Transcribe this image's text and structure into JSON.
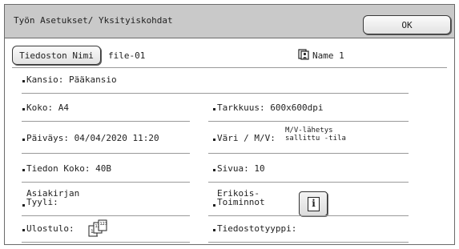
{
  "window": {
    "title": "Työn Asetukset/ Yksityiskohdat",
    "ok_label": "OK"
  },
  "file": {
    "name_button": "Tiedoston Nimi",
    "name_value": "file-01",
    "user_icon": "user-card-icon",
    "user_name": "Name 1"
  },
  "details": {
    "folder": "Kansio: Pääkansio",
    "size": "Koko: A4",
    "resolution": "Tarkkuus: 600x600dpi",
    "date": "Päiväys: 04/04/2020 11:20",
    "color_label": "Väri / M/V:",
    "color_value_line1": "M/V-lähetys",
    "color_value_line2": "sallittu -tila",
    "data_size": "Tiedon Koko: 40B",
    "pages": "Sivua: 10",
    "doc_style_line1": "Asiakirjan",
    "doc_style_line2": "Tyyli:",
    "special_line1": "Erikois-",
    "special_line2": "Toiminnot",
    "info_icon": "info-icon",
    "output": "Ulostulo:",
    "output_icon": "output-sort-icon",
    "file_type": "Tiedostotyyppi:"
  }
}
